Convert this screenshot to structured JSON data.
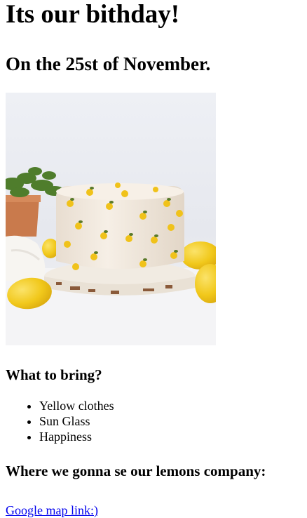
{
  "heading": "Its our bithday!",
  "subheading": "On the 25st of November.",
  "bring": {
    "title": "What to bring?",
    "items": [
      "Yellow clothes",
      "Sun Glass",
      "Happiness"
    ]
  },
  "location": {
    "title": "Where we gonna se our lemons company:",
    "link_label": "Google map link:)"
  },
  "colors": {
    "link": "#0000ee",
    "lemon": "#f1c81b",
    "frosting": "#f4ece1",
    "leaf": "#5a7a2a"
  }
}
